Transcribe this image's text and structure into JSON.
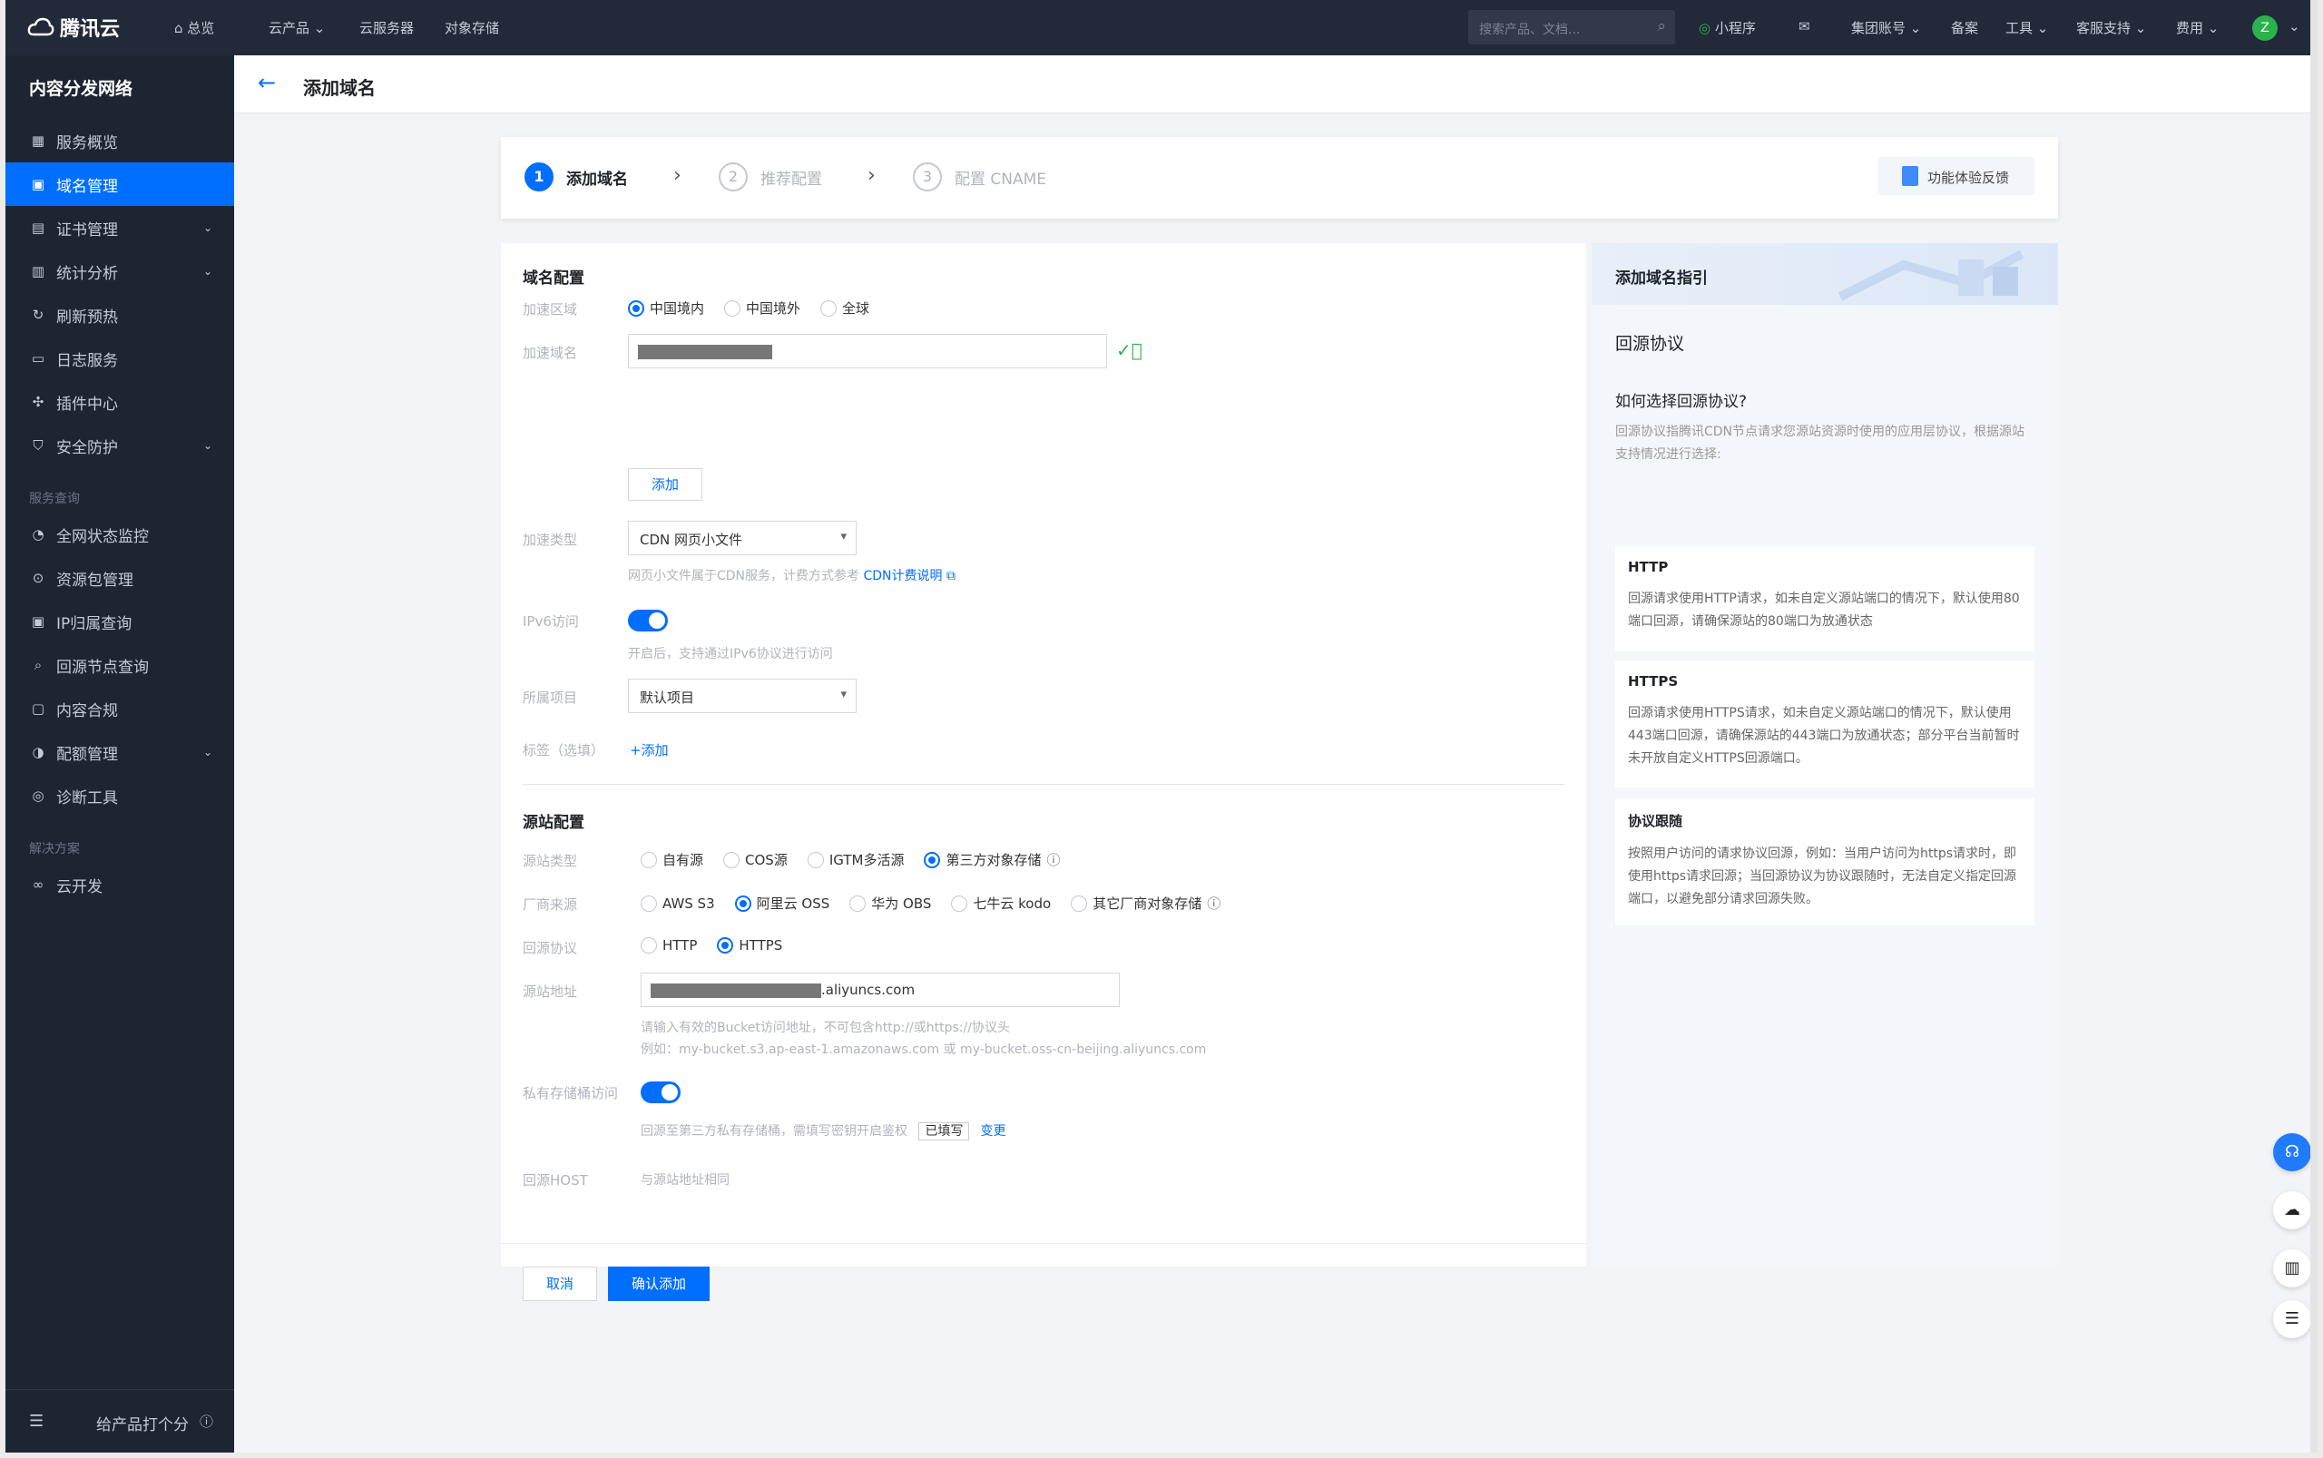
{
  "topbar": {
    "brand": "腾讯云",
    "items": [
      "总览",
      "云产品",
      "云服务器",
      "对象存储"
    ],
    "search_placeholder": "搜索产品、文档...",
    "right": [
      "小程序",
      "集团账号",
      "备案",
      "工具",
      "客服支持",
      "费用"
    ],
    "avatar": "Z"
  },
  "sidebar": {
    "title": "内容分发网络",
    "items": [
      {
        "label": "服务概览",
        "icon": "grid-icon"
      },
      {
        "label": "域名管理",
        "icon": "screen-icon",
        "active": true
      },
      {
        "label": "证书管理",
        "icon": "doc-icon",
        "expandable": true
      },
      {
        "label": "统计分析",
        "icon": "bar-chart-icon",
        "expandable": true
      },
      {
        "label": "刷新预热",
        "icon": "refresh-icon"
      },
      {
        "label": "日志服务",
        "icon": "folder-icon"
      },
      {
        "label": "插件中心",
        "icon": "puzzle-icon"
      },
      {
        "label": "安全防护",
        "icon": "shield-icon",
        "expandable": true
      }
    ],
    "group1": "服务查询",
    "items2": [
      {
        "label": "全网状态监控",
        "icon": "monitor-icon"
      },
      {
        "label": "资源包管理",
        "icon": "package-icon"
      },
      {
        "label": "IP归属查询",
        "icon": "ip-icon"
      },
      {
        "label": "回源节点查询",
        "icon": "search-node-icon"
      },
      {
        "label": "内容合规",
        "icon": "compliance-icon"
      },
      {
        "label": "配额管理",
        "icon": "quota-icon",
        "expandable": true
      },
      {
        "label": "诊断工具",
        "icon": "diagnose-icon"
      }
    ],
    "group2": "解决方案",
    "items3": [
      {
        "label": "云开发",
        "icon": "cloud-dev-icon"
      }
    ],
    "footer": "给产品打个分"
  },
  "page": {
    "title": "添加域名"
  },
  "steps": [
    {
      "num": "1",
      "label": "添加域名"
    },
    {
      "num": "2",
      "label": "推荐配置"
    },
    {
      "num": "3",
      "label": "配置 CNAME"
    }
  ],
  "feedback": "功能体验反馈",
  "form": {
    "section1": "域名配置",
    "region_label": "加速区域",
    "region_options": [
      "中国境内",
      "中国境外",
      "全球"
    ],
    "region_selected": 0,
    "domain_label": "加速域名",
    "add_button": "添加",
    "type_label": "加速类型",
    "type_value": "CDN 网页小文件",
    "type_hint": "网页小文件属于CDN服务，计费方式参考",
    "type_hint_link": "CDN计费说明",
    "ipv6_label": "IPv6访问",
    "ipv6_hint": "开启后，支持通过IPv6协议进行访问",
    "project_label": "所属项目",
    "project_value": "默认项目",
    "tag_label": "标签（选填）",
    "tag_add": "+添加",
    "section2": "源站配置",
    "origin_type_label": "源站类型",
    "origin_type_options": [
      "自有源",
      "COS源",
      "IGTM多活源",
      "第三方对象存储"
    ],
    "origin_type_selected": 3,
    "vendor_label": "厂商来源",
    "vendor_options": [
      "AWS S3",
      "阿里云 OSS",
      "华为 OBS",
      "七牛云 kodo",
      "其它厂商对象存储"
    ],
    "vendor_selected": 1,
    "protocol_label": "回源协议",
    "protocol_options": [
      "HTTP",
      "HTTPS"
    ],
    "protocol_selected": 1,
    "address_label": "源站地址",
    "address_suffix": ".aliyuncs.com",
    "address_hint1": "请输入有效的Bucket访问地址，不可包含http://或https://协议头",
    "address_hint2": "例如：my-bucket.s3.ap-east-1.amazonaws.com 或 my-bucket.oss-cn-beijing.aliyuncs.com",
    "private_label": "私有存储桶访问",
    "private_hint": "回源至第三方私有存储桶，需填写密钥开启鉴权",
    "private_badge": "已填写",
    "private_change": "变更",
    "host_label": "回源HOST",
    "host_value": "与源站地址相同",
    "cancel": "取消",
    "confirm": "确认添加"
  },
  "guide": {
    "title": "添加域名指引",
    "subtitle": "回源协议",
    "question": "如何选择回源协议?",
    "intro": "回源协议指腾讯CDN节点请求您源站资源时使用的应用层协议，根据源站支持情况进行选择:",
    "cards": [
      {
        "title": "HTTP",
        "body": "回源请求使用HTTP请求，如未自定义源站端口的情况下，默认使用80端口回源，请确保源站的80端口为放通状态"
      },
      {
        "title": "HTTPS",
        "body": "回源请求使用HTTPS请求，如未自定义源站端口的情况下，默认使用443端口回源，请确保源站的443端口为放通状态；部分平台当前暂时未开放自定义HTTPS回源端口。"
      },
      {
        "title": "协议跟随",
        "body": "按照用户访问的请求协议回源，例如：当用户访问为https请求时，即使用https请求回源；当回源协议为协议跟随时，无法自定义指定回源端口，以避免部分请求回源失败。"
      }
    ]
  },
  "colors": {
    "accent": "#006eff",
    "sidebar_bg": "#1e2532",
    "topbar_bg": "#222a3a"
  }
}
